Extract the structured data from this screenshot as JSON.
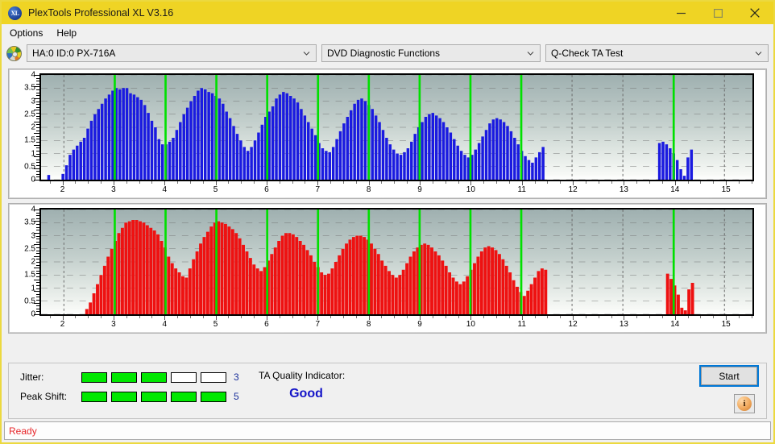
{
  "window": {
    "title": "PlexTools Professional XL V3.16",
    "app_icon": "xl-disc-icon",
    "minimize_label": "–",
    "maximize_label": "□",
    "close_label": "✕"
  },
  "menubar": {
    "items": [
      {
        "label": "Options"
      },
      {
        "label": "Help"
      }
    ]
  },
  "toolbar": {
    "drive_icon": "optical-disc-icon",
    "drive_select": {
      "value": "HA:0 ID:0  PX-716A"
    },
    "function_select": {
      "value": "DVD Diagnostic Functions"
    },
    "test_select": {
      "value": "Q-Check TA Test"
    }
  },
  "chart_data": [
    {
      "type": "bar",
      "title": "Q-Check TA Test - Jitter (top)",
      "xlabel": "",
      "ylabel": "",
      "color": "#1a1ae0",
      "grid": true,
      "xlim": [
        1.55,
        15.55
      ],
      "ylim": [
        0,
        4
      ],
      "yticks": [
        0,
        0.5,
        1,
        1.5,
        2,
        2.5,
        3,
        3.5,
        4
      ],
      "xticks": [
        2,
        3,
        4,
        5,
        6,
        7,
        8,
        9,
        10,
        11,
        12,
        13,
        14,
        15
      ],
      "markers": [
        3,
        4,
        5,
        6,
        7,
        8,
        9,
        10,
        11,
        14
      ],
      "marker_color": "#00e000",
      "bar_width": 0.055,
      "x": [
        1.7,
        1.98,
        2.05,
        2.12,
        2.19,
        2.26,
        2.33,
        2.4,
        2.47,
        2.54,
        2.61,
        2.68,
        2.75,
        2.82,
        2.89,
        2.96,
        3.03,
        3.1,
        3.17,
        3.24,
        3.31,
        3.38,
        3.45,
        3.52,
        3.59,
        3.66,
        3.73,
        3.8,
        3.87,
        3.94,
        4.01,
        4.08,
        4.15,
        4.22,
        4.29,
        4.36,
        4.43,
        4.5,
        4.57,
        4.64,
        4.71,
        4.78,
        4.85,
        4.92,
        4.99,
        5.06,
        5.13,
        5.2,
        5.27,
        5.34,
        5.41,
        5.48,
        5.55,
        5.62,
        5.69,
        5.76,
        5.83,
        5.9,
        5.97,
        6.04,
        6.11,
        6.18,
        6.25,
        6.32,
        6.39,
        6.46,
        6.53,
        6.6,
        6.67,
        6.74,
        6.81,
        6.88,
        6.95,
        7.02,
        7.09,
        7.16,
        7.23,
        7.3,
        7.37,
        7.44,
        7.51,
        7.58,
        7.65,
        7.72,
        7.79,
        7.86,
        7.93,
        8.0,
        8.07,
        8.14,
        8.21,
        8.28,
        8.35,
        8.42,
        8.49,
        8.56,
        8.63,
        8.7,
        8.77,
        8.84,
        8.91,
        8.98,
        9.05,
        9.12,
        9.19,
        9.26,
        9.33,
        9.4,
        9.47,
        9.54,
        9.61,
        9.68,
        9.75,
        9.82,
        9.89,
        9.96,
        10.03,
        10.1,
        10.17,
        10.24,
        10.31,
        10.38,
        10.45,
        10.52,
        10.59,
        10.66,
        10.73,
        10.8,
        10.87,
        10.94,
        11.01,
        11.08,
        11.15,
        11.22,
        11.29,
        11.36,
        11.43,
        13.72,
        13.79,
        13.86,
        13.93,
        14.0,
        14.07,
        14.14,
        14.21,
        14.28,
        14.35
      ],
      "values": [
        0.18,
        0.22,
        0.55,
        0.95,
        1.15,
        1.3,
        1.45,
        1.6,
        1.95,
        2.25,
        2.5,
        2.7,
        2.9,
        3.1,
        3.25,
        3.4,
        3.5,
        3.45,
        3.5,
        3.5,
        3.3,
        3.25,
        3.15,
        3.05,
        2.85,
        2.55,
        2.25,
        2.0,
        1.55,
        1.35,
        1.35,
        1.45,
        1.6,
        1.9,
        2.2,
        2.5,
        2.75,
        3.0,
        3.2,
        3.4,
        3.5,
        3.45,
        3.35,
        3.3,
        3.2,
        3.1,
        2.9,
        2.6,
        2.35,
        2.05,
        1.75,
        1.5,
        1.25,
        1.1,
        1.25,
        1.5,
        1.8,
        2.1,
        2.4,
        2.6,
        2.8,
        3.1,
        3.25,
        3.35,
        3.3,
        3.2,
        3.1,
        2.95,
        2.7,
        2.45,
        2.2,
        1.95,
        1.7,
        1.4,
        1.2,
        1.1,
        1.05,
        1.25,
        1.55,
        1.85,
        2.15,
        2.4,
        2.65,
        2.9,
        3.05,
        3.1,
        3.0,
        2.85,
        2.7,
        2.45,
        2.2,
        1.9,
        1.6,
        1.35,
        1.15,
        1.0,
        0.95,
        1.05,
        1.2,
        1.45,
        1.75,
        2.0,
        2.2,
        2.4,
        2.5,
        2.55,
        2.45,
        2.35,
        2.2,
        2.0,
        1.8,
        1.55,
        1.3,
        1.1,
        0.95,
        0.85,
        0.95,
        1.15,
        1.4,
        1.65,
        1.9,
        2.15,
        2.3,
        2.35,
        2.3,
        2.2,
        2.05,
        1.85,
        1.6,
        1.35,
        1.1,
        0.9,
        0.75,
        0.65,
        0.85,
        1.05,
        1.25,
        1.4,
        1.45,
        1.35,
        1.2,
        1.0,
        0.75,
        0.4,
        0.15,
        0.85,
        1.15,
        1.5,
        1.8,
        2.1,
        2.3,
        2.1,
        1.75,
        1.25,
        0.6
      ]
    },
    {
      "type": "bar",
      "title": "Q-Check TA Test - Peak Shift (bottom)",
      "xlabel": "",
      "ylabel": "",
      "color": "#ee1111",
      "grid": true,
      "xlim": [
        1.55,
        15.55
      ],
      "ylim": [
        0,
        4
      ],
      "yticks": [
        0,
        0.5,
        1,
        1.5,
        2,
        2.5,
        3,
        3.5,
        4
      ],
      "xticks": [
        2,
        3,
        4,
        5,
        6,
        7,
        8,
        9,
        10,
        11,
        12,
        13,
        14,
        15
      ],
      "markers": [
        3,
        4,
        5,
        6,
        7,
        8,
        9,
        10,
        11,
        14
      ],
      "marker_color": "#00e000",
      "bar_width": 0.062,
      "x": [
        2.45,
        2.52,
        2.59,
        2.66,
        2.73,
        2.8,
        2.87,
        2.94,
        3.01,
        3.08,
        3.15,
        3.22,
        3.29,
        3.36,
        3.43,
        3.5,
        3.57,
        3.64,
        3.71,
        3.78,
        3.85,
        3.92,
        3.99,
        4.06,
        4.13,
        4.2,
        4.27,
        4.34,
        4.41,
        4.48,
        4.55,
        4.62,
        4.69,
        4.76,
        4.83,
        4.9,
        4.97,
        5.04,
        5.11,
        5.18,
        5.25,
        5.32,
        5.39,
        5.46,
        5.53,
        5.6,
        5.67,
        5.74,
        5.81,
        5.88,
        5.95,
        6.02,
        6.09,
        6.16,
        6.23,
        6.3,
        6.37,
        6.44,
        6.51,
        6.58,
        6.65,
        6.72,
        6.79,
        6.86,
        6.93,
        7.0,
        7.07,
        7.14,
        7.21,
        7.28,
        7.35,
        7.42,
        7.49,
        7.56,
        7.63,
        7.7,
        7.77,
        7.84,
        7.91,
        7.98,
        8.05,
        8.12,
        8.19,
        8.26,
        8.33,
        8.4,
        8.47,
        8.54,
        8.61,
        8.68,
        8.75,
        8.82,
        8.89,
        8.96,
        9.03,
        9.1,
        9.17,
        9.24,
        9.31,
        9.38,
        9.45,
        9.52,
        9.59,
        9.66,
        9.73,
        9.8,
        9.87,
        9.94,
        10.01,
        10.08,
        10.15,
        10.22,
        10.29,
        10.36,
        10.43,
        10.5,
        10.57,
        10.64,
        10.71,
        10.78,
        10.85,
        10.92,
        10.99,
        11.06,
        11.13,
        11.2,
        11.27,
        11.34,
        11.41,
        11.48,
        13.88,
        13.95,
        14.02,
        14.09,
        14.16,
        14.23,
        14.3,
        14.37
      ],
      "values": [
        0.2,
        0.45,
        0.8,
        1.15,
        1.5,
        1.85,
        2.2,
        2.5,
        2.8,
        3.1,
        3.3,
        3.5,
        3.55,
        3.6,
        3.6,
        3.55,
        3.5,
        3.4,
        3.3,
        3.2,
        3.05,
        2.8,
        2.55,
        2.2,
        1.95,
        1.75,
        1.6,
        1.45,
        1.4,
        1.75,
        2.1,
        2.4,
        2.7,
        2.95,
        3.15,
        3.35,
        3.5,
        3.55,
        3.5,
        3.45,
        3.35,
        3.25,
        3.1,
        2.9,
        2.65,
        2.4,
        2.15,
        1.9,
        1.75,
        1.65,
        1.8,
        2.05,
        2.3,
        2.55,
        2.8,
        3.0,
        3.1,
        3.1,
        3.05,
        2.95,
        2.8,
        2.65,
        2.45,
        2.25,
        2.0,
        1.8,
        1.6,
        1.5,
        1.55,
        1.75,
        2.0,
        2.25,
        2.5,
        2.7,
        2.85,
        2.95,
        3.0,
        3.0,
        2.95,
        2.85,
        2.7,
        2.5,
        2.3,
        2.05,
        1.85,
        1.65,
        1.5,
        1.4,
        1.5,
        1.7,
        1.95,
        2.2,
        2.4,
        2.55,
        2.65,
        2.7,
        2.65,
        2.55,
        2.4,
        2.25,
        2.05,
        1.85,
        1.6,
        1.4,
        1.25,
        1.15,
        1.25,
        1.45,
        1.7,
        1.95,
        2.2,
        2.4,
        2.55,
        2.6,
        2.55,
        2.45,
        2.3,
        2.1,
        1.85,
        1.6,
        1.3,
        1.05,
        0.85,
        0.7,
        0.9,
        1.15,
        1.4,
        1.65,
        1.75,
        1.7,
        1.55,
        1.35,
        1.1,
        0.75,
        0.25,
        0.15,
        0.95,
        1.2,
        1.3,
        1.25,
        1.15,
        1.0,
        0.85
      ]
    }
  ],
  "meters": {
    "jitter": {
      "label": "Jitter:",
      "total": 5,
      "filled": 3,
      "value": "3"
    },
    "peak_shift": {
      "label": "Peak Shift:",
      "total": 5,
      "filled": 5,
      "value": "5"
    }
  },
  "quality": {
    "title": "TA Quality Indicator:",
    "value": "Good",
    "color": "#1414c8"
  },
  "actions": {
    "start_label": "Start",
    "info_icon": "info-icon"
  },
  "status": {
    "text": "Ready",
    "color": "#e8262a"
  }
}
